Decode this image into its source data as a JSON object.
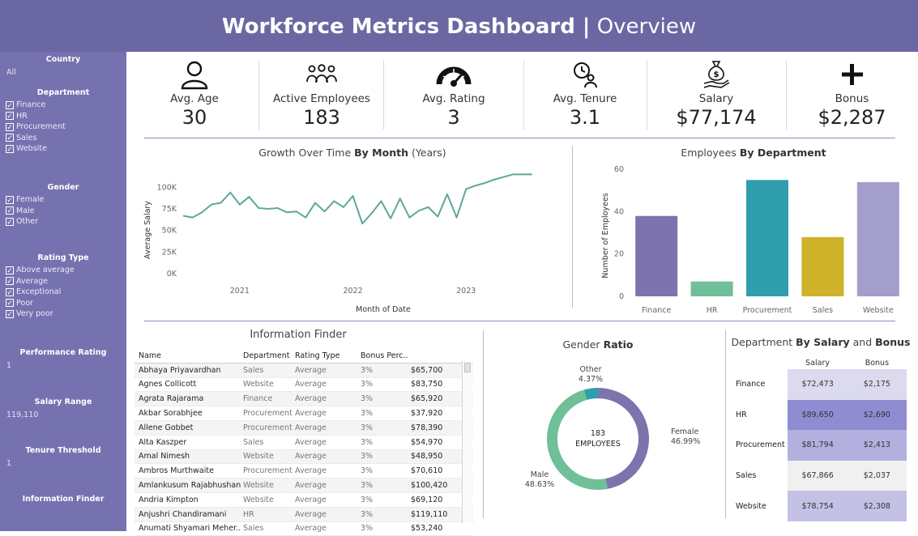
{
  "header": {
    "title_strong": "Workforce Metrics Dashboard |",
    "title_light": "Overview"
  },
  "sidebar": {
    "country": {
      "title": "Country",
      "value": "All"
    },
    "department": {
      "title": "Department",
      "items": [
        "Finance",
        "HR",
        "Procurement",
        "Sales",
        "Website"
      ]
    },
    "gender": {
      "title": "Gender",
      "items": [
        "Female",
        "Male",
        "Other"
      ]
    },
    "rating_type": {
      "title": "Rating Type",
      "items": [
        "Above average",
        "Average",
        "Exceptional",
        "Poor",
        "Very poor"
      ]
    },
    "performance_rating": {
      "title": "Performance Rating",
      "value": "1"
    },
    "salary_range": {
      "title": "Salary Range",
      "value": "119,110"
    },
    "tenure_threshold": {
      "title": "Tenure Threshold",
      "value": "1"
    },
    "information_finder": {
      "title": "Information Finder"
    },
    "check_glyph": "✓"
  },
  "kpis": [
    {
      "icon": "person-icon",
      "label": "Avg. Age",
      "value": "30"
    },
    {
      "icon": "people-group-icon",
      "label": "Active Employees",
      "value": "183"
    },
    {
      "icon": "gauge-icon",
      "label": "Avg. Rating",
      "value": "3"
    },
    {
      "icon": "clock-person-icon",
      "label": "Avg. Tenure",
      "value": "3.1"
    },
    {
      "icon": "money-bag-icon",
      "label": "Salary",
      "value": "$77,174"
    },
    {
      "icon": "plus-icon",
      "label": "Bonus",
      "value": "$2,287"
    }
  ],
  "growth": {
    "title_a": "Growth Over Time",
    "title_b": "By Month",
    "title_c": "(Years)"
  },
  "dept_chart": {
    "title_a": "Employees",
    "title_b": "By Department"
  },
  "info_finder": {
    "title": "Information Finder",
    "columns": [
      "Name",
      "Department",
      "Rating Type",
      "Bonus Perc..",
      ""
    ],
    "rows": [
      [
        "Abhaya Priyavardhan",
        "Sales",
        "Average",
        "3%",
        "$65,700"
      ],
      [
        "Agnes Collicott",
        "Website",
        "Average",
        "3%",
        "$83,750"
      ],
      [
        "Agrata Rajarama",
        "Finance",
        "Average",
        "3%",
        "$65,920"
      ],
      [
        "Akbar Sorabhjee",
        "Procurement",
        "Average",
        "3%",
        "$37,920"
      ],
      [
        "Allene Gobbet",
        "Procurement",
        "Average",
        "3%",
        "$78,390"
      ],
      [
        "Alta Kaszper",
        "Sales",
        "Average",
        "3%",
        "$54,970"
      ],
      [
        "Amal Nimesh",
        "Website",
        "Average",
        "3%",
        "$48,950"
      ],
      [
        "Ambros Murthwaite",
        "Procurement",
        "Average",
        "3%",
        "$70,610"
      ],
      [
        "Amlankusum Rajabhushan",
        "Website",
        "Average",
        "3%",
        "$100,420"
      ],
      [
        "Andria Kimpton",
        "Website",
        "Average",
        "3%",
        "$69,120"
      ],
      [
        "Anjushri Chandiramani",
        "HR",
        "Average",
        "3%",
        "$119,110"
      ],
      [
        "Anumati Shyamari Meher..",
        "Sales",
        "Average",
        "3%",
        "$53,240"
      ]
    ]
  },
  "gender": {
    "title_a": "Gender",
    "title_b": "Ratio",
    "center_value": "183",
    "center_label": "EMPLOYEES",
    "labels": {
      "female": [
        "Female",
        "46.99%"
      ],
      "male": [
        "Male",
        "48.63%"
      ],
      "other": [
        "Other",
        "4.37%"
      ]
    }
  },
  "dept_sal": {
    "title_a": "Department",
    "title_b": "By Salary",
    "title_c": "and",
    "title_d": "Bonus",
    "columns": [
      "Salary",
      "Bonus"
    ],
    "rows": [
      {
        "dept": "Finance",
        "salary": "$72,473",
        "bonus": "$2,175",
        "color": "#dcdaee"
      },
      {
        "dept": "HR",
        "salary": "$89,650",
        "bonus": "$2,690",
        "color": "#8f8cd2"
      },
      {
        "dept": "Procurement",
        "salary": "$81,794",
        "bonus": "$2,413",
        "color": "#b3b0e0"
      },
      {
        "dept": "Sales",
        "salary": "$67,866",
        "bonus": "$2,037",
        "color": "#f0f0f0"
      },
      {
        "dept": "Website",
        "salary": "$78,754",
        "bonus": "$2,308",
        "color": "#c3c1e6"
      }
    ]
  },
  "chart_data": [
    {
      "type": "line",
      "title": "Growth Over Time By Month (Years)",
      "xlabel": "Month of Date",
      "ylabel": "Average Salary",
      "y_ticks": [
        "0K",
        "25K",
        "50K",
        "75K",
        "100K"
      ],
      "x_ticks": [
        "2021",
        "2022",
        "2023"
      ],
      "ylim": [
        0,
        120000
      ],
      "x_start": "2020-07",
      "x_end": "2023-10",
      "x": [
        "2020-07",
        "2020-08",
        "2020-09",
        "2020-10",
        "2020-11",
        "2020-12",
        "2021-01",
        "2021-02",
        "2021-03",
        "2021-04",
        "2021-05",
        "2021-06",
        "2021-07",
        "2021-08",
        "2021-09",
        "2021-10",
        "2021-11",
        "2021-12",
        "2022-01",
        "2022-02",
        "2022-03",
        "2022-04",
        "2022-05",
        "2022-06",
        "2022-07",
        "2022-08",
        "2022-09",
        "2022-10",
        "2022-11",
        "2022-12",
        "2023-01",
        "2023-02",
        "2023-03",
        "2023-04",
        "2023-05",
        "2023-06",
        "2023-07",
        "2023-08",
        "2023-09",
        "2023-10"
      ],
      "series": [
        {
          "color": "#5fa79b",
          "values": [
            67000,
            65000,
            71000,
            80000,
            82000,
            94000,
            80000,
            89000,
            76000,
            75000,
            76000,
            71000,
            72000,
            65000,
            82000,
            72000,
            84000,
            77000,
            90000,
            58000,
            70000,
            84000,
            64000,
            87000,
            65000,
            73000,
            77000,
            66000,
            92000,
            65000,
            98000,
            102000,
            105000,
            109000,
            112000,
            115000,
            115000,
            115000
          ]
        }
      ]
    },
    {
      "type": "bar",
      "title": "Employees By Department",
      "xlabel": "",
      "ylabel": "Number of Employees",
      "categories": [
        "Finance",
        "HR",
        "Procurement",
        "Sales",
        "Website"
      ],
      "values": [
        38,
        7,
        55,
        28,
        54
      ],
      "colors": [
        "#7d74ad",
        "#6fbf97",
        "#2f9fad",
        "#cdb22a",
        "#a49ecb"
      ],
      "ylim": [
        0,
        62
      ],
      "y_ticks": [
        "0",
        "20",
        "40",
        "60"
      ]
    },
    {
      "type": "pie",
      "title": "Gender Ratio",
      "categories": [
        "Female",
        "Male",
        "Other"
      ],
      "values": [
        46.99,
        48.63,
        4.37
      ],
      "colors": [
        "#7d74ad",
        "#6fbf97",
        "#2f9fad"
      ]
    }
  ]
}
